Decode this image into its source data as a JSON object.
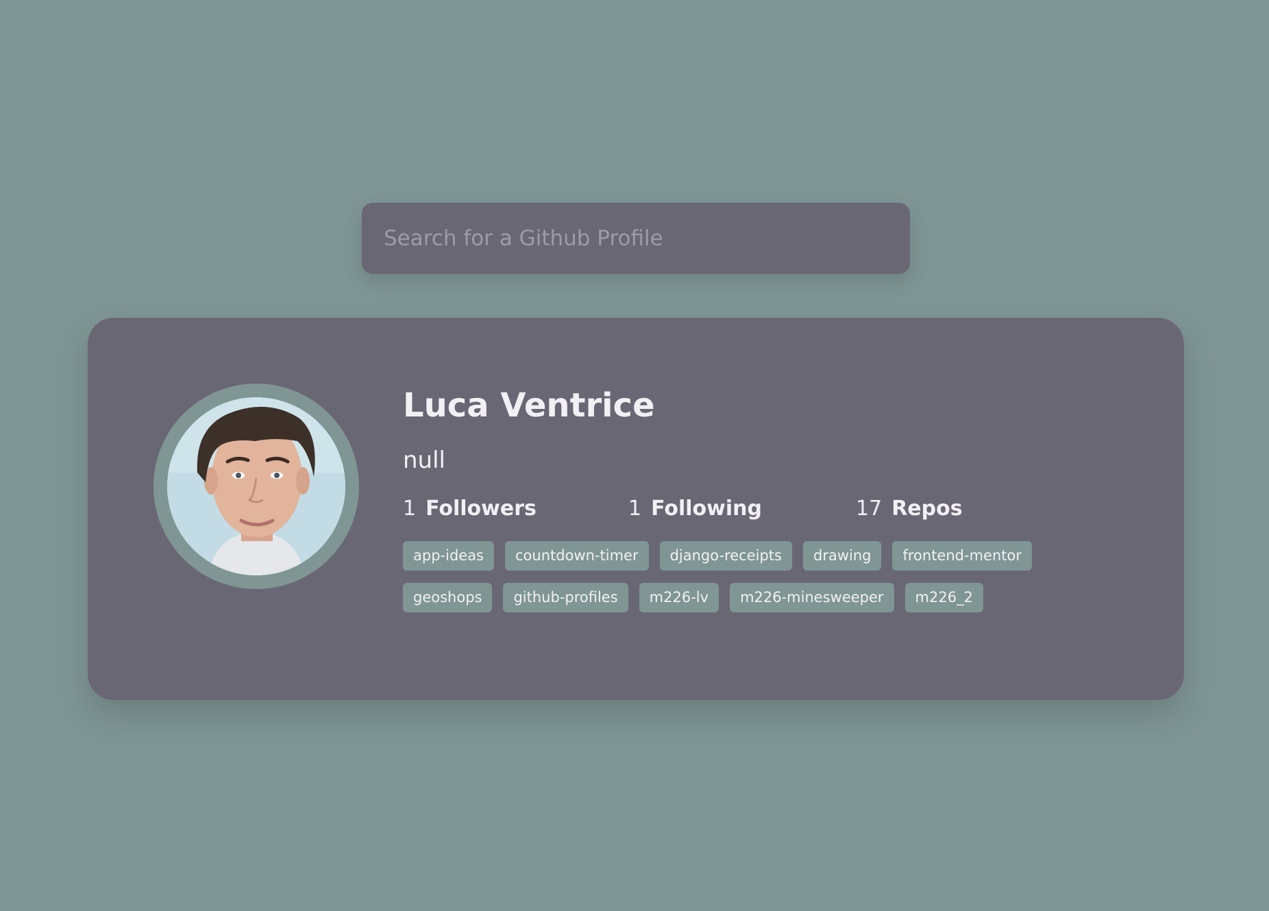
{
  "colors": {
    "background": "#7f9694",
    "panel": "#6a6774",
    "chip": "#7f9694",
    "text": "#f2f0f4",
    "placeholder": "#9e9ba6"
  },
  "search": {
    "placeholder": "Search for a Github Profile",
    "value": ""
  },
  "profile": {
    "avatar_icon": "profile-photo",
    "name": "Luca Ventrice",
    "bio": "null",
    "stats": [
      {
        "value": "1",
        "label": "Followers"
      },
      {
        "value": "1",
        "label": "Following"
      },
      {
        "value": "17",
        "label": "Repos"
      }
    ],
    "repos": [
      "app-ideas",
      "countdown-timer",
      "django-receipts",
      "drawing",
      "frontend-mentor",
      "geoshops",
      "github-profiles",
      "m226-lv",
      "m226-minesweeper",
      "m226_2"
    ]
  }
}
